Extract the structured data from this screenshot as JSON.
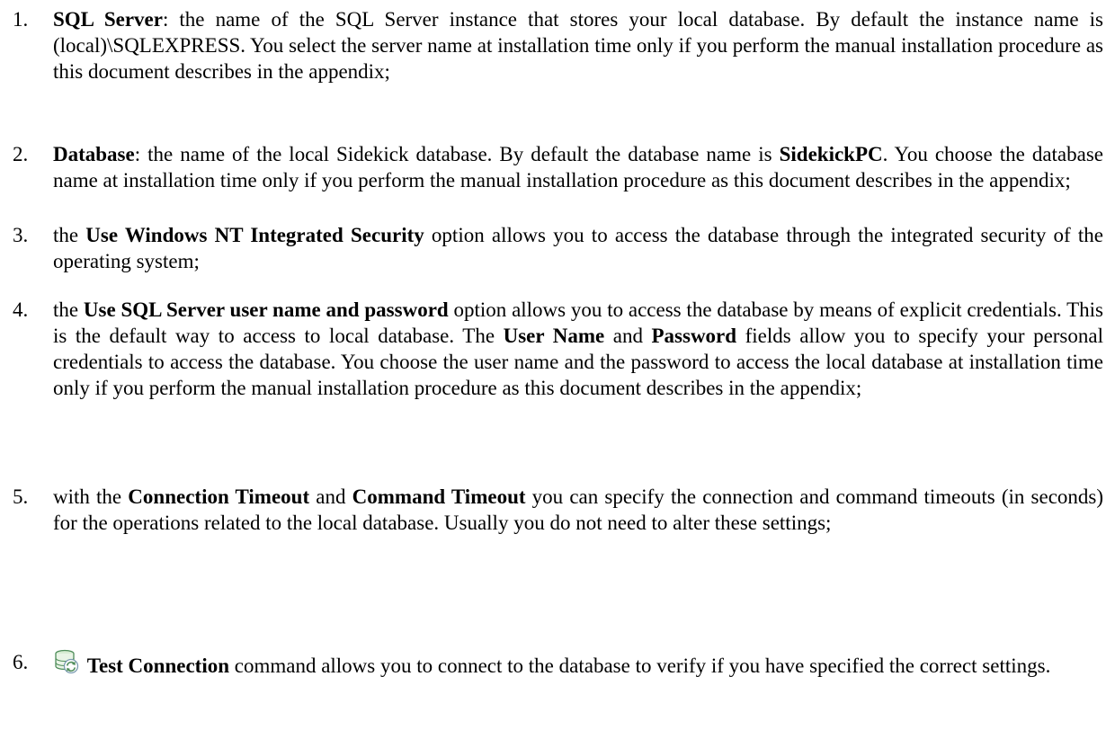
{
  "items": [
    {
      "number": "1.",
      "segments": [
        {
          "text": "SQL Server",
          "bold": true
        },
        {
          "text": ": the name of the SQL Server instance that stores your local database.  By default the instance name is (local)\\SQLEXPRESS.  You select the server name at installation time only if you perform the manual installation procedure as this document describes in the appendix;",
          "bold": false
        }
      ]
    },
    {
      "number": "2.",
      "segments": [
        {
          "text": "Database",
          "bold": true
        },
        {
          "text": ": the name of the local Sidekick database.  By default the database name is ",
          "bold": false
        },
        {
          "text": "SidekickPC",
          "bold": true
        },
        {
          "text": ".  You choose the database name at installation time only if you perform the manual installation procedure as this document describes in the appendix;",
          "bold": false
        }
      ]
    },
    {
      "number": "3.",
      "segments": [
        {
          "text": "the ",
          "bold": false
        },
        {
          "text": "Use Windows NT Integrated Security",
          "bold": true
        },
        {
          "text": " option allows you to access the database through the integrated security of the operating system;",
          "bold": false
        }
      ]
    },
    {
      "number": "4.",
      "segments": [
        {
          "text": "the ",
          "bold": false
        },
        {
          "text": "Use SQL Server user name and password",
          "bold": true
        },
        {
          "text": " option allows you to access the database by means of explicit credentials.  This is the default way to access to local database.  The ",
          "bold": false
        },
        {
          "text": "User Name",
          "bold": true
        },
        {
          "text": " and ",
          "bold": false
        },
        {
          "text": "Password",
          "bold": true
        },
        {
          "text": " fields allow you to specify your personal credentials to access the database.  You choose the user name and the password to access the local database at installation time only if you perform the manual installation procedure as this document describes in the appendix;",
          "bold": false
        }
      ]
    },
    {
      "number": "5.",
      "segments": [
        {
          "text": "with the ",
          "bold": false
        },
        {
          "text": "Connection Timeout",
          "bold": true
        },
        {
          "text": " and ",
          "bold": false
        },
        {
          "text": "Command Timeout",
          "bold": true
        },
        {
          "text": " you can specify the connection and command timeouts (in seconds) for the operations related to the local database.  Usually you do not need to alter these settings;",
          "bold": false
        }
      ]
    },
    {
      "number": "6.",
      "icon": "database-refresh-icon",
      "segments": [
        {
          "text": " ",
          "bold": false
        },
        {
          "text": "Test Connection",
          "bold": true
        },
        {
          "text": " command allows you to connect to the database to verify if you have specified the correct settings.",
          "bold": false
        }
      ]
    }
  ]
}
